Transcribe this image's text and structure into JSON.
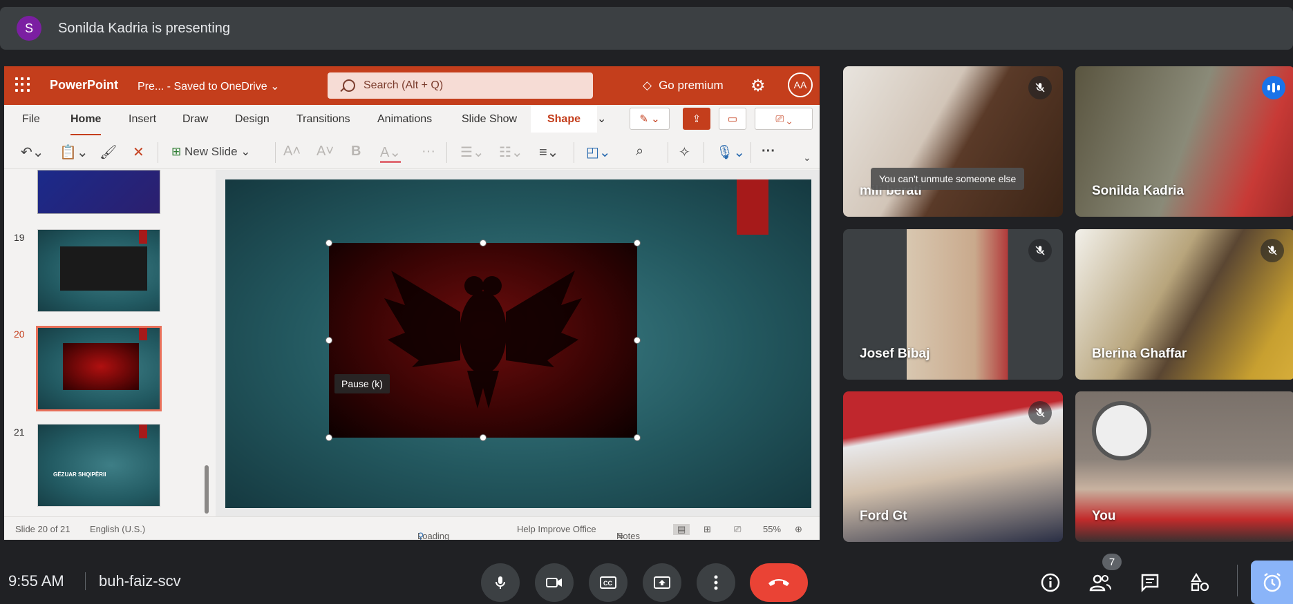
{
  "presenter": {
    "avatar_letter": "S",
    "text": "Sonilda Kadria is presenting"
  },
  "ppt": {
    "app_name": "PowerPoint",
    "doc_name": "Pre...  -  Saved to OneDrive",
    "search_placeholder": "Search (Alt + Q)",
    "premium_label": "Go premium",
    "account_initials": "AA",
    "tabs": [
      "File",
      "Home",
      "Insert",
      "Draw",
      "Design",
      "Transitions",
      "Animations",
      "Slide Show",
      "Shape"
    ],
    "active_tab": "Home",
    "new_slide_label": "New Slide",
    "thumbnails": [
      {
        "number": "19"
      },
      {
        "number": "20"
      },
      {
        "number": "21",
        "text": "GËZUAR SHQIPËRII"
      }
    ],
    "video_tooltip": "Pause (k)",
    "status": {
      "slide_info": "Slide 20 of 21",
      "language": "English (U.S.)",
      "addins": "Loading Add-ins",
      "help": "Help Improve Office",
      "notes": "Notes",
      "zoom": "55%"
    }
  },
  "participants": [
    {
      "name": "mili berati",
      "muted": true
    },
    {
      "name": "Sonilda Kadria",
      "speaking": true
    },
    {
      "name": "Josef Bibaj",
      "muted": true
    },
    {
      "name": "Blerina Ghaffar",
      "muted": true
    },
    {
      "name": "Ford Gt",
      "muted": true
    },
    {
      "name": "You",
      "muted": false
    }
  ],
  "unmute_tooltip": "You can't unmute someone else",
  "bottom": {
    "time": "9:55 AM",
    "meeting_code": "buh-faiz-scv",
    "participant_count": "7"
  },
  "colors": {
    "ppt_brand": "#c43e1c",
    "hangup": "#ea4335",
    "meet_bg": "#202124"
  }
}
